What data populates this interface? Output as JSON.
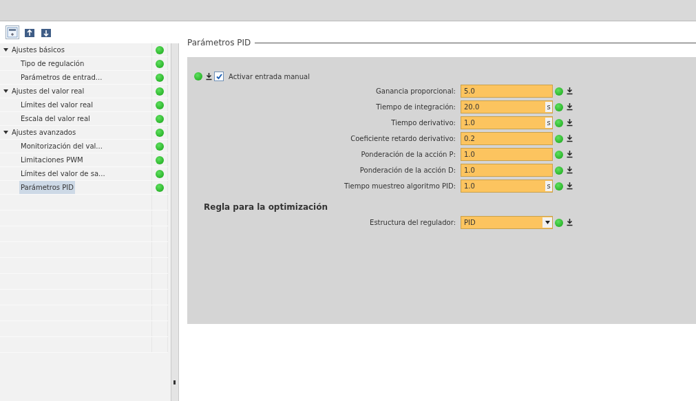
{
  "tree": [
    {
      "label": "Ajustes básicos",
      "expanded": true,
      "selected": false,
      "children": [
        {
          "label": "Tipo de regulación",
          "selected": false
        },
        {
          "label": "Parámetros de entrad...",
          "selected": false
        }
      ]
    },
    {
      "label": "Ajustes del valor real",
      "expanded": true,
      "selected": false,
      "children": [
        {
          "label": "Límites del valor real",
          "selected": false
        },
        {
          "label": "Escala del valor real",
          "selected": false
        }
      ]
    },
    {
      "label": "Ajustes avanzados",
      "expanded": true,
      "selected": false,
      "children": [
        {
          "label": "Monitorización del val...",
          "selected": false
        },
        {
          "label": "Limitaciones PWM",
          "selected": false
        },
        {
          "label": "Límites del valor de sa...",
          "selected": false
        },
        {
          "label": "Parámetros PID",
          "selected": true
        }
      ]
    }
  ],
  "section_title": "Parámetros PID",
  "manual_input": {
    "label": "Activar entrada manual",
    "checked": true
  },
  "fields": [
    {
      "kind": "number",
      "label": "Ganancia proporcional:",
      "value": "5.0"
    },
    {
      "kind": "number",
      "label": "Tiempo de integración:",
      "value": "20.0",
      "unit": "s"
    },
    {
      "kind": "number",
      "label": "Tiempo derivativo:",
      "value": "1.0",
      "unit": "s"
    },
    {
      "kind": "number",
      "label": "Coeficiente retardo derivativo:",
      "value": "0.2"
    },
    {
      "kind": "number",
      "label": "Ponderación de la acción P:",
      "value": "1.0"
    },
    {
      "kind": "number",
      "label": "Ponderación de la acción D:",
      "value": "1.0"
    },
    {
      "kind": "number",
      "label": "Tiempo muestreo algoritmo PID:",
      "value": "1.0",
      "unit": "s"
    }
  ],
  "optimization": {
    "title": "Regla para la optimización",
    "fields": [
      {
        "kind": "dropdown",
        "label": "Estructura del regulador:",
        "value": "PID"
      }
    ]
  }
}
